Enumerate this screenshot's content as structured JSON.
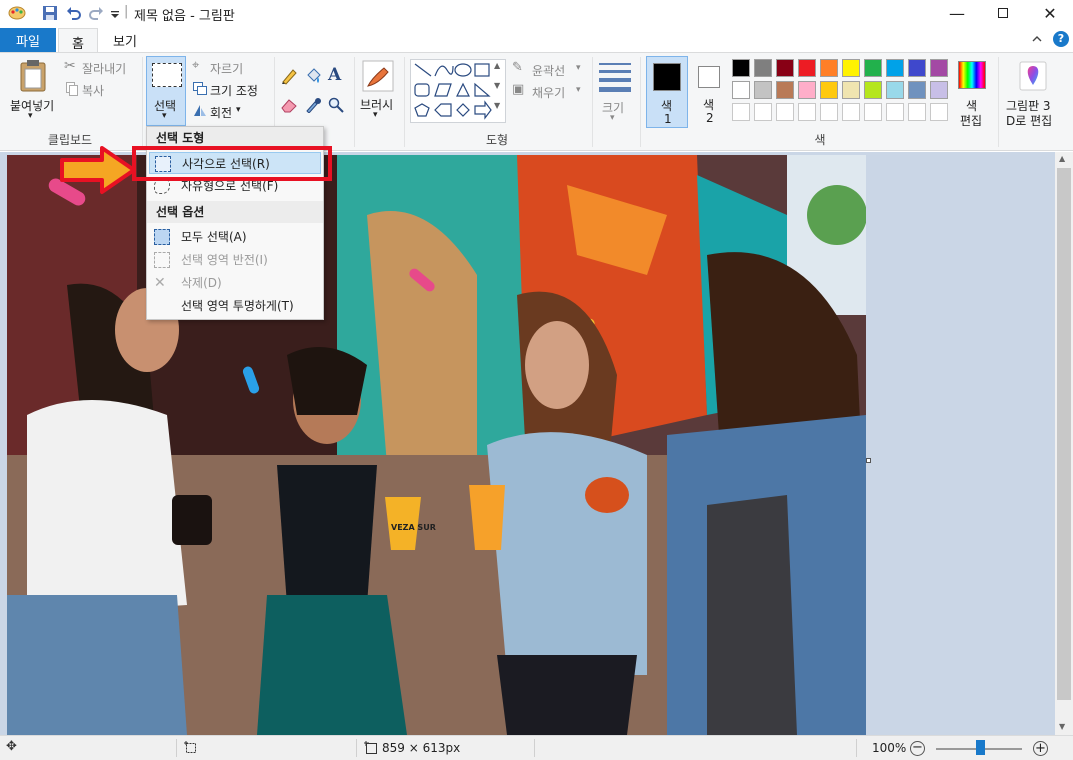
{
  "titlebar": {
    "title": "제목 없음 - 그림판",
    "sep": "|"
  },
  "tabs": [
    {
      "label": "파일"
    },
    {
      "label": "홈"
    },
    {
      "label": "보기"
    }
  ],
  "ribbon": {
    "clipboard": {
      "paste": "붙여넣기",
      "cut": "잘라내기",
      "copy": "복사",
      "group": "클립보드"
    },
    "image": {
      "select": "선택",
      "crop": "자르기",
      "resize": "크기 조정",
      "rotate": "회전"
    },
    "brushes": "브러시",
    "shapes": {
      "outline": "윤곽선",
      "fill": "채우기",
      "group": "도형"
    },
    "size": "크기",
    "color1": {
      "line1": "색",
      "line2": "1"
    },
    "color2": {
      "line1": "색",
      "line2": "2"
    },
    "edit_colors": {
      "line1": "색",
      "line2": "편집"
    },
    "paint3d": {
      "line1": "그림판 3",
      "line2": "D로 편집"
    },
    "colors_group": "색",
    "palette_row1": [
      "#000000",
      "#7f7f7f",
      "#880015",
      "#ed1c24",
      "#ff7f27",
      "#fff200",
      "#22b14c",
      "#00a2e8",
      "#3f48cc",
      "#a349a4"
    ],
    "palette_row2": [
      "#ffffff",
      "#c3c3c3",
      "#b97a57",
      "#ffaec9",
      "#ffc90e",
      "#efe4b0",
      "#b5e61d",
      "#99d9ea",
      "#7092be",
      "#c8bfe7"
    ]
  },
  "dropdown": {
    "header_shape": "선택 도형",
    "rect_select": "사각으로 선택(R)",
    "free_select": "자유형으로 선택(F)",
    "header_options": "선택 옵션",
    "select_all": "모두 선택(A)",
    "invert": "선택 영역 반전(I)",
    "delete": "삭제(D)",
    "transparent": "선택 영역 투명하게(T)"
  },
  "status": {
    "image_size": "859 × 613px",
    "zoom": "100%"
  },
  "colors": {
    "accent": "#1979ca",
    "highlight_red": "#e81123",
    "ribbon_bg": "#f5f6f7",
    "workarea": "#cad6e6"
  },
  "photo": {
    "can_text": "VEZA SUR"
  }
}
